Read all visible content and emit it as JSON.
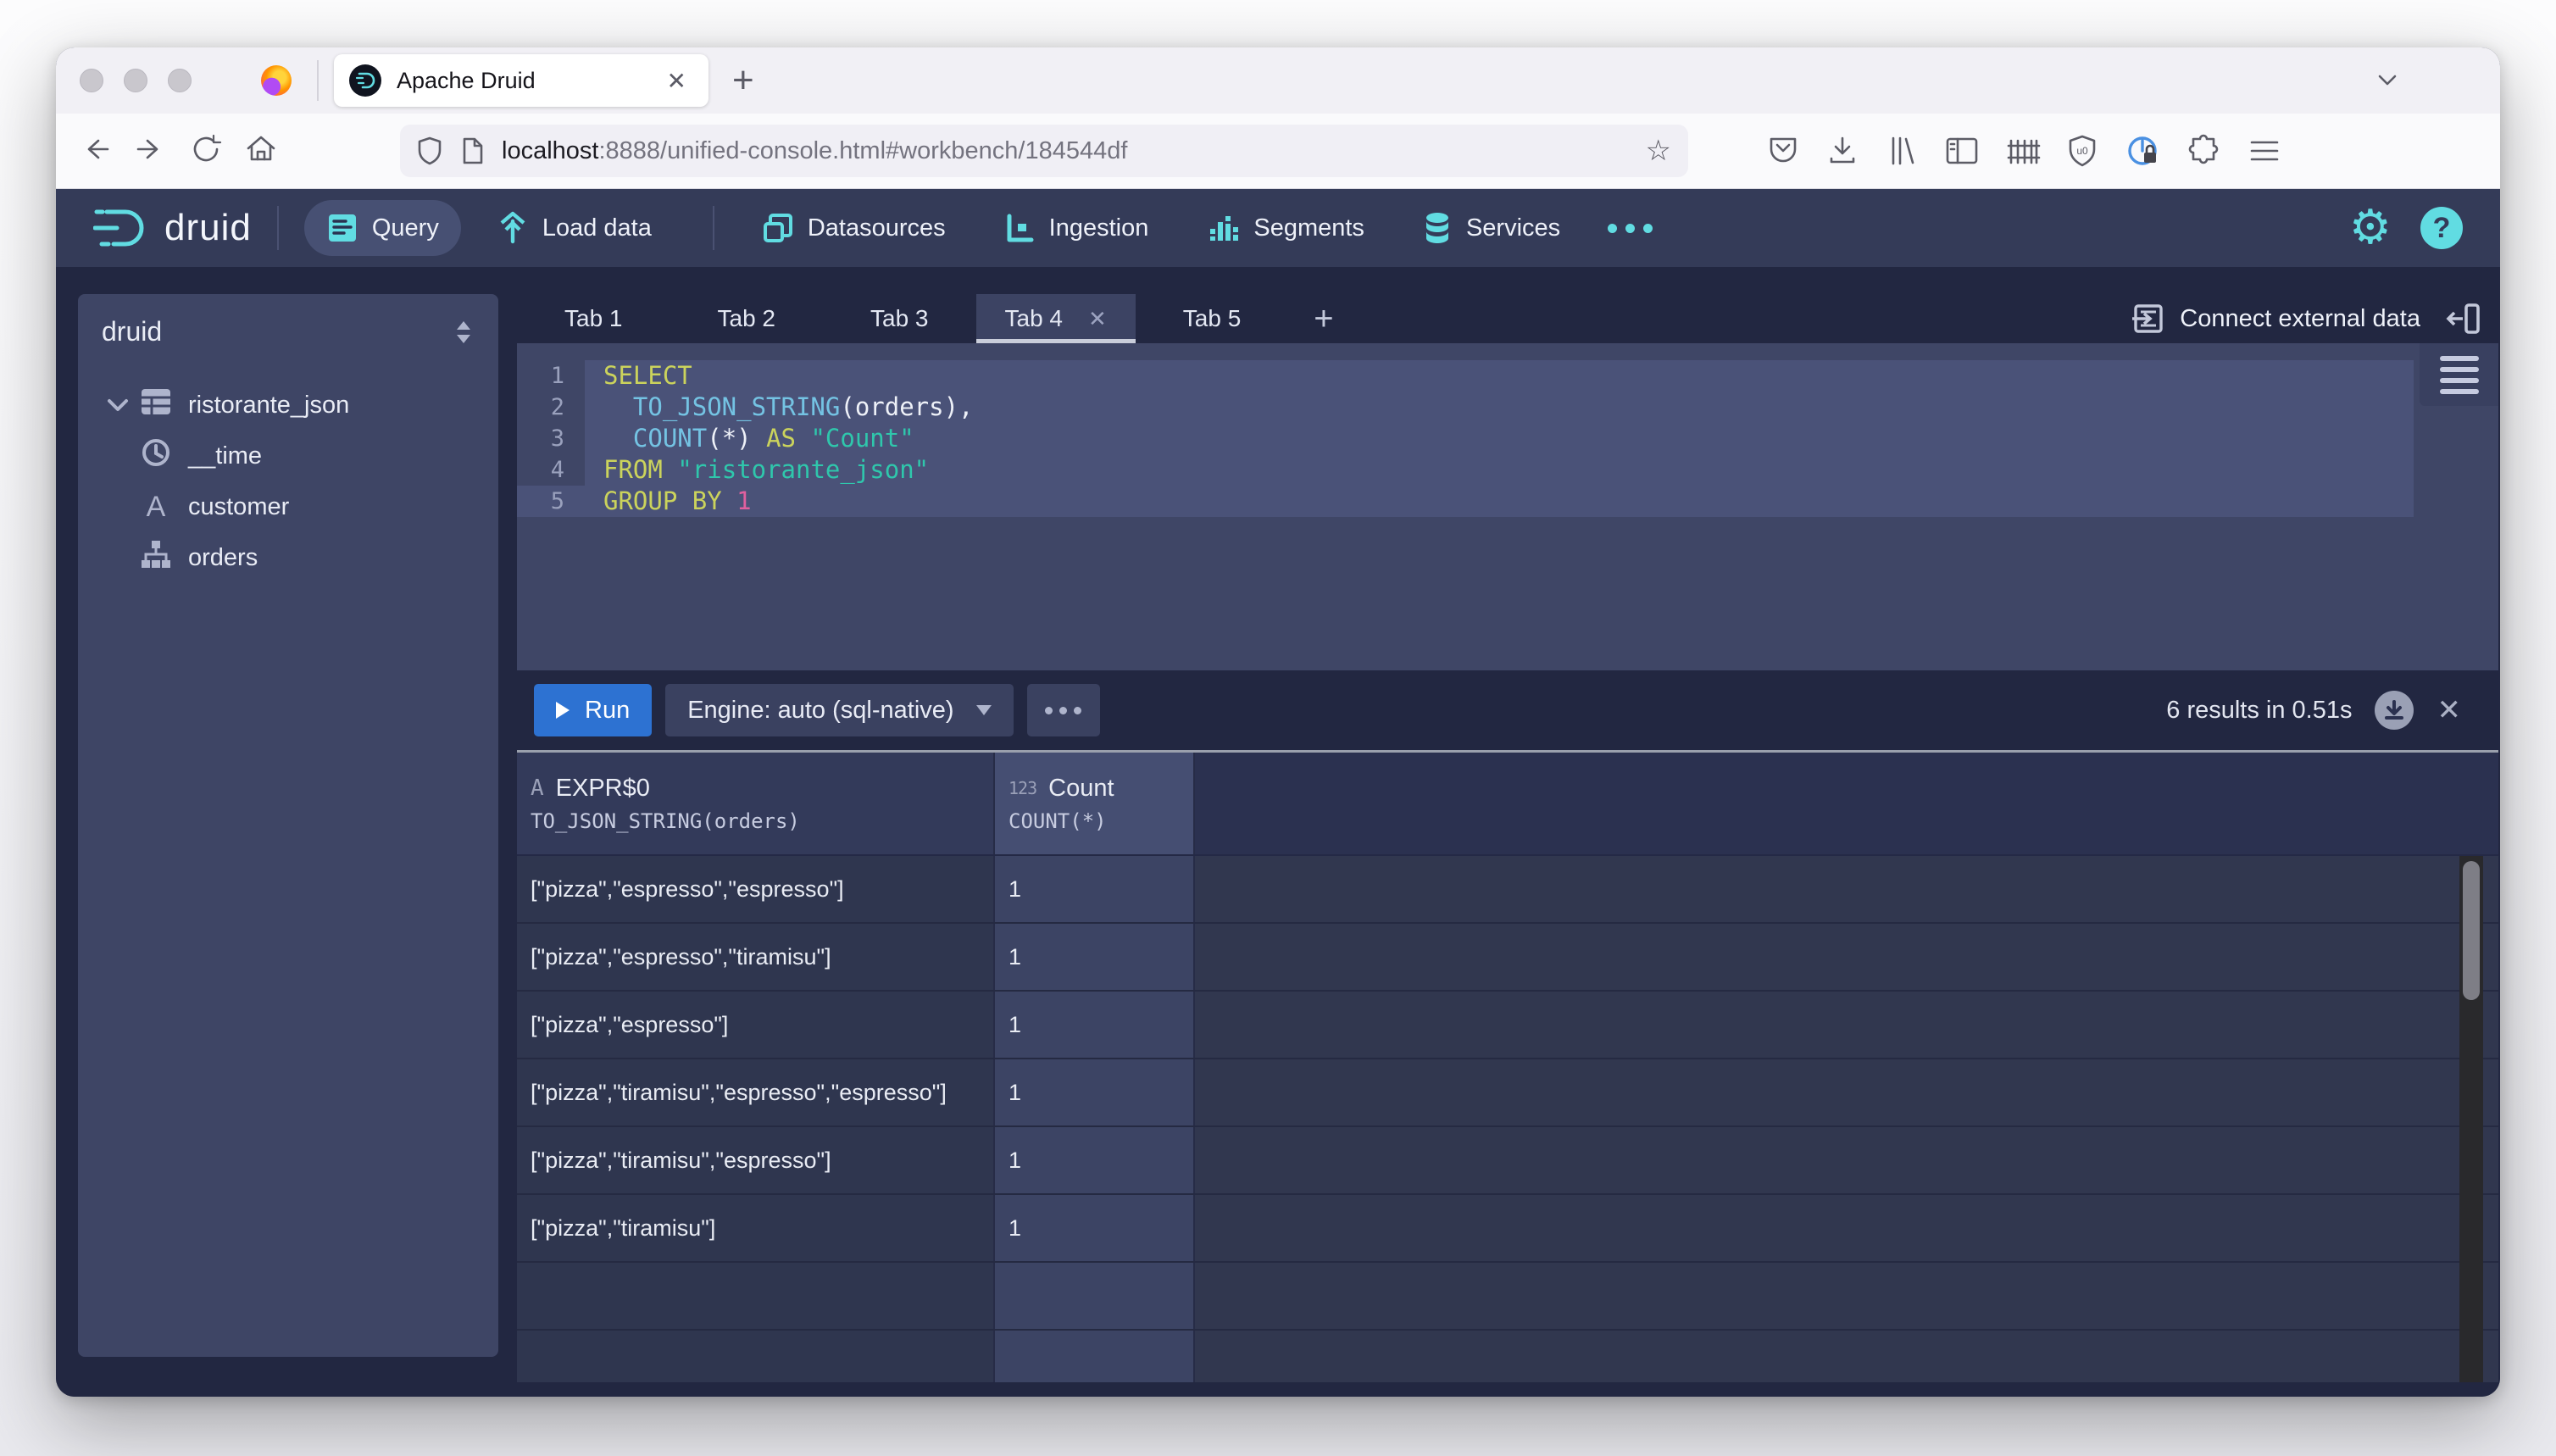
{
  "icons": {
    "plus": "+",
    "close": "✕",
    "star": "☆",
    "question": "?",
    "gear": "⚙",
    "ellipsis": "..."
  },
  "browser": {
    "tab_title": "Apache Druid",
    "url_host": "localhost",
    "url_rest": ":8888/unified-console.html#workbench/184544df"
  },
  "header": {
    "brand": "druid",
    "nav": [
      {
        "label": "Query",
        "active": true
      },
      {
        "label": "Load data",
        "active": false
      },
      {
        "label": "Datasources",
        "active": false
      },
      {
        "label": "Ingestion",
        "active": false
      },
      {
        "label": "Segments",
        "active": false
      },
      {
        "label": "Services",
        "active": false
      }
    ]
  },
  "sidebar": {
    "schema": "druid",
    "items": [
      {
        "label": "ristorante_json",
        "type": "table",
        "expanded": true
      },
      {
        "label": "__time",
        "type": "time"
      },
      {
        "label": "customer",
        "type": "string"
      },
      {
        "label": "orders",
        "type": "complex"
      }
    ]
  },
  "workbench": {
    "tabs": [
      {
        "label": "Tab 1"
      },
      {
        "label": "Tab 2"
      },
      {
        "label": "Tab 3"
      },
      {
        "label": "Tab 4",
        "active": true
      },
      {
        "label": "Tab 5"
      }
    ],
    "connect_button": "Connect external data",
    "run_button": "Run",
    "engine_button": "Engine: auto (sql-native)",
    "results_summary": "6 results in 0.51s"
  },
  "sql": {
    "lines": [
      [
        {
          "t": "kw",
          "v": "SELECT"
        }
      ],
      [
        {
          "t": "pl",
          "v": "  "
        },
        {
          "t": "fn",
          "v": "TO_JSON_STRING"
        },
        {
          "t": "pl",
          "v": "(orders),"
        }
      ],
      [
        {
          "t": "pl",
          "v": "  "
        },
        {
          "t": "fn",
          "v": "COUNT"
        },
        {
          "t": "pl",
          "v": "(*) "
        },
        {
          "t": "kw",
          "v": "AS"
        },
        {
          "t": "pl",
          "v": " "
        },
        {
          "t": "str",
          "v": "\"Count\""
        }
      ],
      [
        {
          "t": "kw",
          "v": "FROM"
        },
        {
          "t": "pl",
          "v": " "
        },
        {
          "t": "str",
          "v": "\"ristorante_json\""
        }
      ],
      [
        {
          "t": "kw",
          "v": "GROUP BY"
        },
        {
          "t": "pl",
          "v": " "
        },
        {
          "t": "num",
          "v": "1"
        }
      ]
    ]
  },
  "results": {
    "columns": [
      {
        "type_icon": "A",
        "name": "EXPR$0",
        "expr": "TO_JSON_STRING(orders)"
      },
      {
        "type_icon": "123",
        "name": "Count",
        "expr": "COUNT(*)"
      }
    ],
    "rows": [
      {
        "expr": "[\"pizza\",\"espresso\",\"espresso\"]",
        "count": "1"
      },
      {
        "expr": "[\"pizza\",\"espresso\",\"tiramisu\"]",
        "count": "1"
      },
      {
        "expr": "[\"pizza\",\"espresso\"]",
        "count": "1"
      },
      {
        "expr": "[\"pizza\",\"tiramisu\",\"espresso\",\"espresso\"]",
        "count": "1"
      },
      {
        "expr": "[\"pizza\",\"tiramisu\",\"espresso\"]",
        "count": "1"
      },
      {
        "expr": "[\"pizza\",\"tiramisu\"]",
        "count": "1"
      }
    ],
    "empty_trailing_rows": 2
  },
  "colors": {
    "accent": "#61dce2",
    "run_button": "#2d72d2",
    "header_bg": "#343b58",
    "panel_bg": "#3e4565"
  }
}
